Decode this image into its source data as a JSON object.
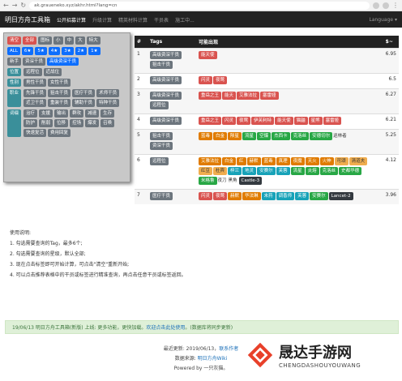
{
  "browser": {
    "url": "ak.graueneko.xyz/akhr.html?lang=cn"
  },
  "navbar": {
    "brand": "明日方舟工具箱",
    "links": [
      "公开招募计算",
      "升级计算",
      "精英材料计算",
      "干员表",
      "施工中..."
    ],
    "language": "Language ▾"
  },
  "filters": {
    "row1": [
      "清空",
      "全部",
      "图标",
      "小",
      "中",
      "大",
      "特大"
    ],
    "row2": [
      "ALL",
      "6★",
      "5★",
      "4★",
      "3★",
      "2★",
      "1★"
    ],
    "row3": [
      "新手",
      "资深干员",
      "高级资深干员"
    ],
    "groups": [
      {
        "label": "位置",
        "items": [
          "远程位",
          "近战位"
        ]
      },
      {
        "label": "性别",
        "items": [
          "男性干员",
          "女性干员"
        ]
      },
      {
        "label": "职业",
        "items": [
          "先锋干员",
          "狙击干员",
          "医疗干员",
          "术师干员",
          "近卫干员",
          "重装干员",
          "辅助干员",
          "特种干员"
        ]
      },
      {
        "label": "词缀",
        "items": [
          "治疗",
          "支援",
          "输出",
          "群攻",
          "减速",
          "生存",
          "防护",
          "削弱",
          "位移",
          "控场",
          "爆发",
          "召唤",
          "快速复活",
          "费用回复"
        ]
      }
    ]
  },
  "table": {
    "headers": [
      "#",
      "Tags",
      "可能出现",
      "$~"
    ],
    "rows": [
      {
        "num": "1",
        "tags": [
          {
            "t": "高级资深干员",
            "c": "gray"
          },
          {
            "t": "狙击干员",
            "c": "gray"
          }
        ],
        "chars": [
          {
            "t": "能天使",
            "c": "red"
          }
        ],
        "price": "6.95"
      },
      {
        "num": "2",
        "tags": [
          {
            "t": "高级资深干员",
            "c": "gray"
          }
        ],
        "chars": [
          {
            "t": "闪灵",
            "c": "red"
          },
          {
            "t": "夜莺",
            "c": "red"
          }
        ],
        "price": "6.5"
      },
      {
        "num": "3",
        "tags": [
          {
            "t": "高级资深干员",
            "c": "gray"
          },
          {
            "t": "远程位",
            "c": "gray"
          }
        ],
        "chars": [
          {
            "t": "重岳之王",
            "c": "red"
          },
          {
            "t": "能天",
            "c": "red"
          },
          {
            "t": "艾雅法拉",
            "c": "red"
          },
          {
            "t": "塞雷娅",
            "c": "red"
          }
        ],
        "price": "6.27"
      },
      {
        "num": "4",
        "tags": [
          {
            "t": "高级资深干员",
            "c": "gray"
          }
        ],
        "chars": [
          {
            "t": "重岳之王",
            "c": "red"
          },
          {
            "t": "闪灵",
            "c": "red"
          },
          {
            "t": "夜莺",
            "c": "red"
          },
          {
            "t": "伊芙利特",
            "c": "red"
          },
          {
            "t": "能天使",
            "c": "red"
          },
          {
            "t": "猫鼬",
            "c": "red"
          },
          {
            "t": "星熊",
            "c": "red"
          },
          {
            "t": "塞雷娅",
            "c": "red"
          }
        ],
        "price": "6.21"
      },
      {
        "num": "5",
        "tags": [
          {
            "t": "狙击干员",
            "c": "gray"
          },
          {
            "t": "资深干员",
            "c": "gray"
          }
        ],
        "chars": [
          {
            "t": "蓝毒",
            "c": "orange"
          },
          {
            "t": "白金",
            "c": "orange"
          },
          {
            "t": "陨星",
            "c": "orange"
          },
          {
            "t": "流星",
            "c": "green"
          },
          {
            "t": "空爆",
            "c": "green"
          },
          {
            "t": "杰西卡",
            "c": "green"
          },
          {
            "t": "克洛丝",
            "c": "green"
          },
          {
            "t": "安德切尔",
            "c": "green"
          },
          {
            "t": "巡林者",
            "c": "plain"
          }
        ],
        "price": "5.25"
      },
      {
        "num": "6",
        "tags": [
          {
            "t": "远程位",
            "c": "gray"
          }
        ],
        "chars": [
          {
            "t": "艾雅法拉",
            "c": "orange"
          },
          {
            "t": "白金",
            "c": "orange"
          },
          {
            "t": "红",
            "c": "orange"
          },
          {
            "t": "赫默",
            "c": "orange"
          },
          {
            "t": "蓝毒",
            "c": "orange"
          },
          {
            "t": "真理",
            "c": "orange"
          },
          {
            "t": "夜魔",
            "c": "orange"
          },
          {
            "t": "天火",
            "c": "orange"
          },
          {
            "t": "火神",
            "c": "orange"
          },
          {
            "t": "可颂",
            "c": "yellow"
          },
          {
            "t": "清道夫",
            "c": "yellow"
          },
          {
            "t": "红豆",
            "c": "yellow"
          },
          {
            "t": "杜宾",
            "c": "yellow"
          },
          {
            "t": "梓兰",
            "c": "cyan"
          },
          {
            "t": "地灵",
            "c": "cyan"
          },
          {
            "t": "安赛尔",
            "c": "cyan"
          },
          {
            "t": "芙蓉",
            "c": "cyan"
          },
          {
            "t": "流星",
            "c": "green"
          },
          {
            "t": "炎熔",
            "c": "green"
          },
          {
            "t": "克洛丝",
            "c": "green"
          },
          {
            "t": "史都华德",
            "c": "green"
          },
          {
            "t": "米格鲁",
            "c": "green"
          },
          {
            "t": "夜刀",
            "c": "plain"
          },
          {
            "t": "黑角",
            "c": "plain"
          },
          {
            "t": "Castle-3",
            "c": "dark"
          }
        ],
        "price": "4.12"
      },
      {
        "num": "7",
        "tags": [
          {
            "t": "医疗干员",
            "c": "gray"
          }
        ],
        "chars": [
          {
            "t": "闪灵",
            "c": "red"
          },
          {
            "t": "夜莺",
            "c": "red"
          },
          {
            "t": "赫默",
            "c": "orange"
          },
          {
            "t": "华法琳",
            "c": "orange"
          },
          {
            "t": "末药",
            "c": "cyan"
          },
          {
            "t": "调香师",
            "c": "cyan"
          },
          {
            "t": "芙蓉",
            "c": "cyan"
          },
          {
            "t": "安赛尔",
            "c": "green"
          },
          {
            "t": "Lancet-2",
            "c": "dark"
          }
        ],
        "price": "3.96"
      }
    ]
  },
  "instructions": {
    "title": "使用说明:",
    "items": [
      "1. 勾选需要查询的Tag，最多6个;",
      "2. 勾选需要查询的星级，默认全部;",
      "3. 现在点击标签即可开始计算，可点击\"清空\"重新开始;",
      "4. 可以点击推荐表格中的干员或标签进行精准查询，再点击任意干员或标签返回。"
    ]
  },
  "alert": {
    "text": "19/06/13 明日方舟工具箱(新版) 上线: 更多功能，更快加载。",
    "link": "欢迎点击此处使用",
    "tail": "。(数据库将同步更新)"
  },
  "footer": {
    "updated": "最近更新: 2019/06/13，",
    "contact": "联系作者",
    "source_label": "数据来源: ",
    "source_link": "明日方舟Wiki",
    "powered": "Powered by 一只灰猫。"
  },
  "watermark": {
    "big": "晟达手游网",
    "small": "CHENGDASHOUYOUWANG"
  }
}
